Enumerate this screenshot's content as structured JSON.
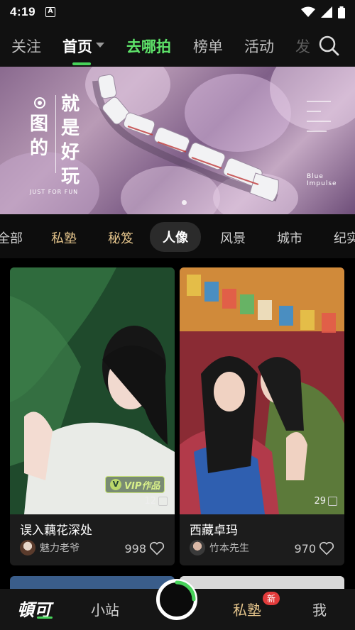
{
  "status": {
    "time": "4:19",
    "app_icon": "A"
  },
  "top_tabs": [
    "关注",
    "首页",
    "去哪拍",
    "榜单",
    "活动",
    "发"
  ],
  "banner": {
    "vertical_text_left": [
      "图",
      "的"
    ],
    "vertical_text_right": [
      "就",
      "是",
      "好",
      "玩"
    ],
    "subtitle": "JUST FOR FUN",
    "brand": "Blue Impulse"
  },
  "categories": [
    "全部",
    "私塾",
    "秘笈",
    "人像",
    "风景",
    "城市",
    "纪实"
  ],
  "cards": [
    {
      "title": "误入藕花深处",
      "author": "魅力老爷",
      "likes": "998",
      "count": "12",
      "vip": "VIP作品"
    },
    {
      "title": "西藏卓玛",
      "author": "竹本先生",
      "likes": "970",
      "count": "29"
    }
  ],
  "bottom_nav": {
    "home_logo": "頓可",
    "store": "小站",
    "private": "私塾",
    "private_badge": "新",
    "me": "我"
  },
  "colors": {
    "accent_green": "#47d35a",
    "gold": "#e5c58c",
    "badge_red": "#e23b3b"
  }
}
